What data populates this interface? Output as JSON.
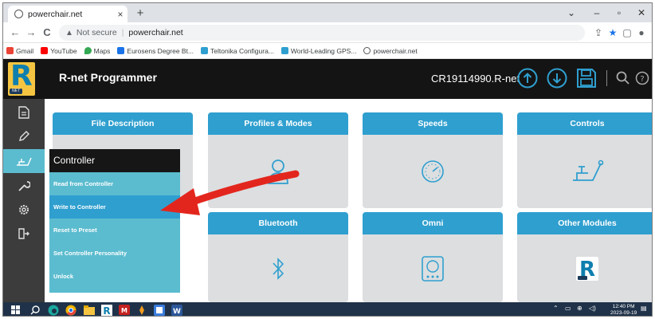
{
  "browser": {
    "tab_title": "powerchair.net",
    "tab_close": "×",
    "new_tab": "+",
    "url_warning": "Not secure",
    "url": "powerchair.net",
    "window_controls": {
      "chevron": "⌄",
      "minimize": "–",
      "maximize": "▫",
      "close": "✕"
    },
    "nav": {
      "back": "←",
      "forward": "→",
      "reload": "C"
    },
    "bookmarks": [
      {
        "label": "Gmail",
        "color": "#ea4335"
      },
      {
        "label": "YouTube",
        "color": "#ff0000"
      },
      {
        "label": "Maps",
        "color": "#34a853"
      },
      {
        "label": "Eurosens Degree Bt...",
        "color": "#1a73e8"
      },
      {
        "label": "Teltonika Configura...",
        "color": "#2f9fcf"
      },
      {
        "label": "World-Leading GPS...",
        "color": "#2f9fcf"
      },
      {
        "label": "powerchair.net",
        "color": "#555555"
      }
    ]
  },
  "app": {
    "title": "R-net Programmer",
    "filename": "CR19114990.R-net",
    "logo_letter": "R",
    "logo_tag": "NET",
    "accent": "#2f9fcf",
    "menu_color": "#5bbccf"
  },
  "cards": [
    {
      "title": "File Description",
      "icon": "none"
    },
    {
      "title": "Profiles & Modes",
      "icon": "user-icon"
    },
    {
      "title": "Speeds",
      "icon": "gauge-icon"
    },
    {
      "title": "Controls",
      "icon": "joystick-icon"
    },
    {
      "title": "Bluetooth",
      "icon": "bluetooth-icon"
    },
    {
      "title": "Omni",
      "icon": "omni-icon"
    },
    {
      "title": "Other Modules",
      "icon": "rnet-logo-icon"
    }
  ],
  "controller_menu": {
    "title": "Controller",
    "items": [
      "Read from Controller",
      "Write to Controller",
      "Reset to Preset",
      "Set Controller Personality",
      "Unlock"
    ],
    "highlighted_item": "Write to Controller"
  },
  "taskbar": {
    "time": "12:40 PM",
    "date": "2023-09-19"
  }
}
